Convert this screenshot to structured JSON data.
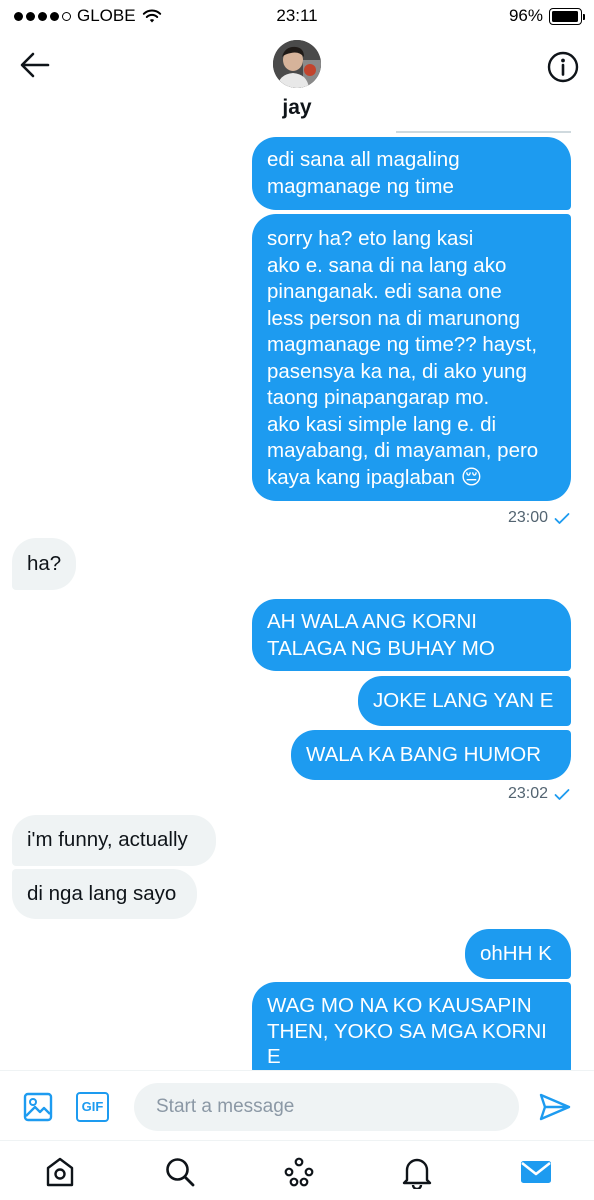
{
  "status_bar": {
    "carrier": "GLOBE",
    "time": "23:11",
    "battery": "96%",
    "battery_level": 0.96
  },
  "header": {
    "contact_name": "jay"
  },
  "messages": [
    {
      "side": "out",
      "text": "edi sana all magaling\nmagmanage ng time"
    },
    {
      "side": "out",
      "text": "sorry ha? eto lang kasi\nako e. sana di na lang ako\npinanganak. edi sana one\nless person na di marunong\nmagmanage ng time?? hayst,\npasensya ka na, di ako yung\ntaong pinapangarap mo.\nako kasi simple lang e. di\nmayabang, di mayaman, pero\nkaya kang ipaglaban 😔"
    },
    {
      "side": "out_meta",
      "time": "23:00"
    },
    {
      "side": "in",
      "text": "ha?"
    },
    {
      "side": "out",
      "text": "AH WALA ANG KORNI\nTALAGA NG BUHAY MO"
    },
    {
      "side": "out",
      "text": "JOKE LANG YAN E"
    },
    {
      "side": "out",
      "text": "WALA KA BANG HUMOR"
    },
    {
      "side": "out_meta",
      "time": "23:02"
    },
    {
      "side": "in",
      "text": "i'm funny, actually"
    },
    {
      "side": "in",
      "text": "di nga lang sayo"
    },
    {
      "side": "out",
      "text": "ohHH K"
    },
    {
      "side": "out",
      "text": "WAG MO NA KO KAUSAPIN\nTHEN, YOKO SA MGA KORNI\nE"
    }
  ],
  "composer": {
    "placeholder": "Start a message",
    "gif_label": "GIF"
  },
  "icons": {
    "back": "arrow-left-icon",
    "info": "info-icon",
    "image": "image-icon",
    "gif": "gif-icon",
    "send": "send-icon",
    "home": "home-icon",
    "search": "search-icon",
    "spaces": "spaces-icon",
    "notifications": "bell-icon",
    "messages": "mail-icon"
  },
  "colors": {
    "accent": "#1d9bf0",
    "incoming_bubble": "#eff3f4",
    "muted_text": "#536471"
  }
}
